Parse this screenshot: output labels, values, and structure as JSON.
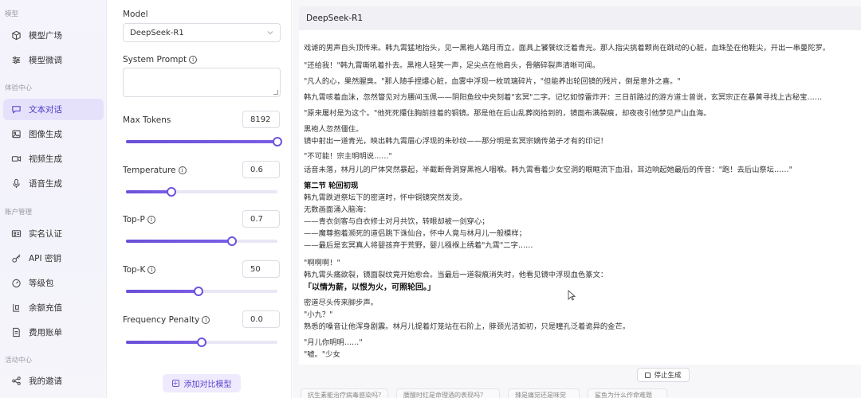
{
  "nav": {
    "sections": [
      "模型",
      "体验中心",
      "账户管理",
      "活动中心"
    ],
    "items": [
      {
        "label": "模型广场",
        "icon": "cube-icon"
      },
      {
        "label": "模型微调",
        "icon": "tune-icon"
      },
      {
        "label": "文本对话",
        "icon": "chat-icon",
        "active": true
      },
      {
        "label": "图像生成",
        "icon": "image-icon"
      },
      {
        "label": "视频生成",
        "icon": "video-icon"
      },
      {
        "label": "语音生成",
        "icon": "mic-icon"
      },
      {
        "label": "实名认证",
        "icon": "id-card-icon"
      },
      {
        "label": "API 密钥",
        "icon": "key-icon"
      },
      {
        "label": "等级包",
        "icon": "gauge-icon"
      },
      {
        "label": "余额充值",
        "icon": "wallet-icon"
      },
      {
        "label": "费用账单",
        "icon": "bill-icon"
      },
      {
        "label": "我的邀请",
        "icon": "share-icon"
      }
    ]
  },
  "params": {
    "model_label": "Model",
    "model_value": "DeepSeek-R1",
    "system_prompt_label": "System Prompt",
    "sliders": [
      {
        "label": "Max Tokens",
        "value": "8192",
        "fraction": 1.0,
        "info": false
      },
      {
        "label": "Temperature",
        "value": "0.6",
        "fraction": 0.3,
        "info": true
      },
      {
        "label": "Top-P",
        "value": "0.7",
        "fraction": 0.7,
        "info": true
      },
      {
        "label": "Top-K",
        "value": "50",
        "fraction": 0.48,
        "info": true
      },
      {
        "label": "Frequency Penalty",
        "value": "0.0",
        "fraction": 0.5,
        "info": true
      }
    ],
    "compare_button": "添加对比模型"
  },
  "chat": {
    "header": "DeepSeek-R1",
    "lines": [
      {
        "text": "戏谑的男声自头顶传来。韩九霄猛地抬头，见一黑袍人踏月而立，面具上饕餮纹泛着青光。那人指尖挑着颗尚在跳动的心脏，血珠坠在他鞋尖，开出一串曼陀罗。",
        "style": ""
      },
      {
        "text": "\"还给我！\"韩九霄嘶吼着扑去。黑袍人轻笑一声，足尖点在他肩头，骨骼碎裂声清晰可闻。",
        "style": ""
      },
      {
        "text": "\"凡人的心，果然腥臭。\"那人随手捏爆心脏，血雾中浮现一枚琉璃碎片，\"但能养出轮回镜的残片，倒是意外之喜。\"",
        "style": ""
      },
      {
        "text": "韩九霄咳着血沫，忽然瞥见对方腰间玉佩——阴阳鱼纹中央刻着\"玄冥\"二字。记忆如惊雷炸开：三日前路过的游方道士曾说，玄冥宗正在暴黄寻找上古秘宝……",
        "style": ""
      },
      {
        "text": "\"原来屠村是为这个。\"他死死攥住胸前挂着的铜镜。那是他在后山乱葬岗拾到的，镜面布满裂痕，却夜夜引他梦见尸山血海。",
        "style": ""
      },
      {
        "text": "黑袍人忽然僵住。",
        "style": ""
      },
      {
        "text": "镜中射出一道青光，映出韩九霄眉心浮现的朱砂纹——那分明是玄冥宗嫡传弟子才有的印记！",
        "style": ""
      },
      {
        "text": "\"不可能！宗主明明说……\"",
        "style": ""
      },
      {
        "text": "话音未落，林月儿的尸体突然暴起，半截断骨洞穿黑袍人咽喉。韩九霄看着少女空洞的眼眶流下血泪，耳边响起她最后的传音：\"跑！去后山祭坛……\"",
        "style": ""
      },
      {
        "text": "第二节 轮回初现",
        "style": "bold"
      },
      {
        "text": "韩九霄跌进祭坛下的密道时，怀中铜镜突然发烫。",
        "style": ""
      },
      {
        "text": "无数画面涌入脑海：",
        "style": ""
      },
      {
        "text": "——青衣剑客与白衣修士对月共饮，转眼却被一剑穿心；",
        "style": ""
      },
      {
        "text": "——魔尊抱着濒死的道侣跳下诛仙台，怀中人竟与林月儿一般模样；",
        "style": ""
      },
      {
        "text": "——最后是玄冥真人将婴孩弃于荒野，婴儿襁褓上绣着\"九霄\"二字……",
        "style": ""
      },
      {
        "text": "\"啊啊啊！\"",
        "style": ""
      },
      {
        "text": "韩九霄头痛欲裂，镜面裂纹竟开始愈合。当最后一道裂痕消失时，他看见镜中浮现血色篆文：",
        "style": ""
      },
      {
        "text": "「以情为薪，以恨为火，可照轮回。」",
        "style": "b2"
      },
      {
        "text": "密道尽头传来脚步声。",
        "style": ""
      },
      {
        "text": "\"小九？\"",
        "style": ""
      },
      {
        "text": "熟悉的嗓音让他浑身剧震。林月儿提着灯笼站在石阶上，脖颈光洁如初，只是瞳孔泛着诡异的金芒。",
        "style": ""
      },
      {
        "text": "\"月儿你明明……\"",
        "style": ""
      },
      {
        "text": "\"嘘。\"少女",
        "style": ""
      }
    ],
    "stop_button": "停止生成",
    "suggestions": [
      "抗生素能治疗病毒感染吗？",
      "腰酸时红是命理酒的表现吗？",
      "辣是痛觉还是味觉",
      "鲨鱼为什么作命难题"
    ]
  }
}
